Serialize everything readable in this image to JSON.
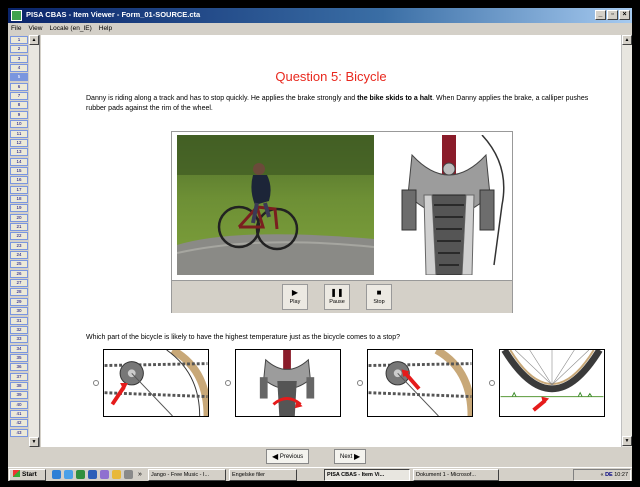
{
  "window": {
    "title": "PISA CBAS - Item Viewer - Form_01-SOURCE.cta",
    "controls": [
      "_",
      "▫",
      "×"
    ]
  },
  "menu": [
    "File",
    "View",
    "Locale (en_IE)",
    "Help"
  ],
  "rail": {
    "pages": [
      "1",
      "2",
      "3",
      "4",
      "5",
      "6",
      "7",
      "8",
      "9",
      "10",
      "11",
      "12",
      "13",
      "14",
      "15",
      "16",
      "17",
      "18",
      "19",
      "20",
      "21",
      "22",
      "23",
      "24",
      "25",
      "26",
      "27",
      "28",
      "29",
      "30",
      "31",
      "32",
      "33",
      "34",
      "35",
      "36",
      "37",
      "38",
      "39",
      "40",
      "41",
      "42",
      "43"
    ],
    "active_page": "5"
  },
  "question": {
    "title": "Question 5: Bicycle",
    "intro_part1": "Danny is riding along a track and has to stop quickly. He applies the brake strongly and ",
    "intro_bold": "the bike skids to a halt",
    "intro_part2": ". When Danny applies the brake, a calliper pushes rubber pads against the rim of the wheel.",
    "prompt": "Which part of the bicycle is likely to have the highest temperature just as the bicycle comes to a stop?"
  },
  "media_controls": {
    "play": "Play",
    "pause": "Pause",
    "stop": "Stop"
  },
  "options": [
    {
      "id": "chain-gear"
    },
    {
      "id": "brake-pads"
    },
    {
      "id": "gear-hub"
    },
    {
      "id": "tyre-ground"
    }
  ],
  "navigation": {
    "previous": "Previous",
    "next": "Next"
  },
  "taskbar": {
    "start": "Start",
    "overflow": "»",
    "tasks": [
      {
        "label": "Jango - Free Music - I...",
        "active": false
      },
      {
        "label": "Engelske filer",
        "active": false
      },
      {
        "label": "PISA CBAS - Item Vi...",
        "active": true
      },
      {
        "label": "Dokument 1 - Microsof...",
        "active": false
      }
    ],
    "tray_extra": "«",
    "tray_lang": "DE",
    "clock": "10:27"
  },
  "colors": {
    "title_red": "#e8281e",
    "titlebar": "#0a246a"
  }
}
